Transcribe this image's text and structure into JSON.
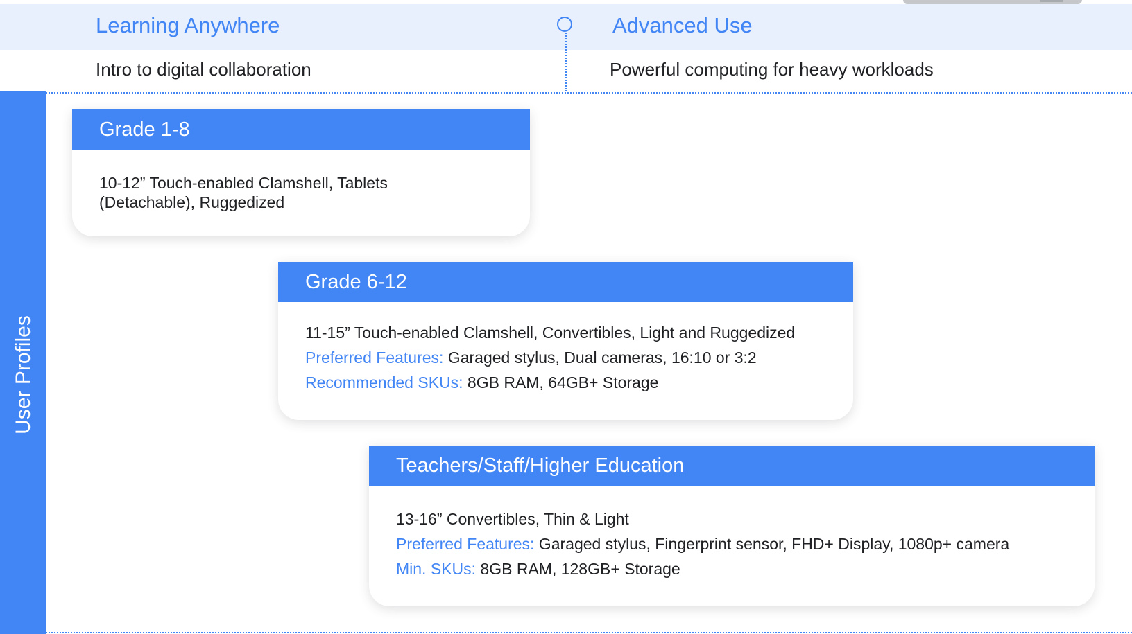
{
  "columns": {
    "left": {
      "title": "Learning Anywhere",
      "subtitle": "Intro to digital collaboration"
    },
    "right": {
      "title": "Advanced Use",
      "subtitle": "Powerful computing for heavy workloads"
    }
  },
  "side_label": "User Profiles",
  "cards": [
    {
      "title": "Grade 1-8",
      "description": "10-12” Touch-enabled Clamshell, Tablets (Detachable), Ruggedized"
    },
    {
      "title": "Grade 6-12",
      "description": "11-15” Touch-enabled Clamshell, Convertibles, Light and Ruggedized",
      "features_label": "Preferred Features:",
      "features_value": " Garaged stylus, Dual cameras, 16:10 or 3:2",
      "skus_label": "Recommended SKUs:",
      "skus_value": " 8GB RAM, 64GB+ Storage"
    },
    {
      "title": "Teachers/Staff/Higher Education",
      "description": "13-16” Convertibles, Thin & Light",
      "features_label": "Preferred Features:",
      "features_value": " Garaged stylus, Fingerprint sensor, FHD+ Display, 1080p+ camera",
      "skus_label": "Min. SKUs:",
      "skus_value": " 8GB RAM, 128GB+ Storage"
    }
  ],
  "colors": {
    "accent": "#4285f4",
    "band": "#e8f0fe",
    "text": "#202124",
    "card_background": "#ffffff"
  }
}
